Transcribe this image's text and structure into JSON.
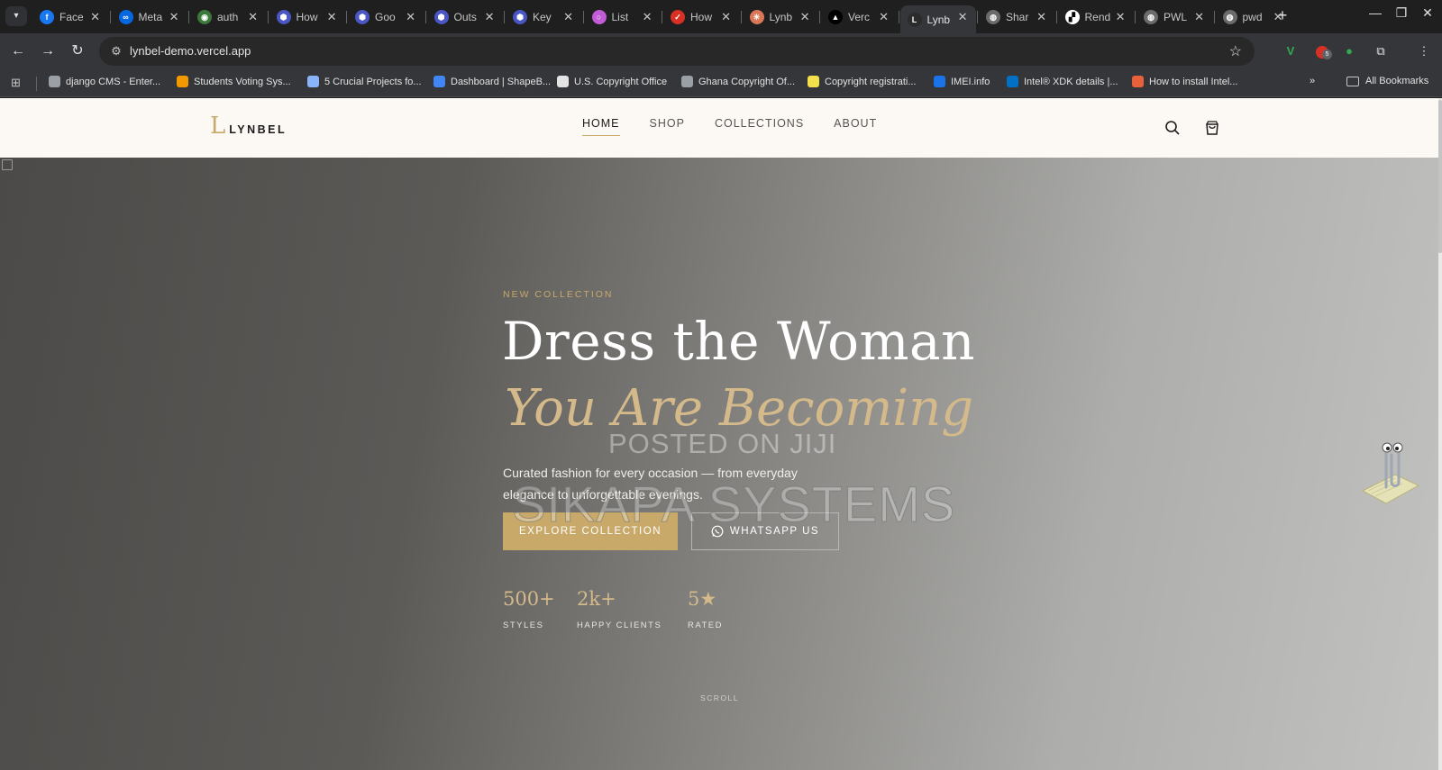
{
  "browser": {
    "tabs": [
      {
        "title": "Face",
        "favicon": "facebook-icon",
        "color": "#1877f2",
        "glyph": "f"
      },
      {
        "title": "Meta",
        "favicon": "meta-icon",
        "color": "#0668e1",
        "glyph": "∞"
      },
      {
        "title": "auth",
        "favicon": "eye-icon",
        "color": "#3c7a3c",
        "glyph": "◉"
      },
      {
        "title": "How",
        "favicon": "shield-icon",
        "color": "#4a56c4",
        "glyph": "⬢"
      },
      {
        "title": "Goo",
        "favicon": "shield-icon",
        "color": "#4a56c4",
        "glyph": "⬢"
      },
      {
        "title": "Outs",
        "favicon": "shield-icon",
        "color": "#4a56c4",
        "glyph": "⬢"
      },
      {
        "title": "Key",
        "favicon": "shield-icon",
        "color": "#4a56c4",
        "glyph": "⬢"
      },
      {
        "title": "List",
        "favicon": "ring-icon",
        "color": "#c25bd6",
        "glyph": "○"
      },
      {
        "title": "How",
        "favicon": "check-icon",
        "color": "#d93025",
        "glyph": "✓"
      },
      {
        "title": "Lynb",
        "favicon": "asterisk-icon",
        "color": "#d97757",
        "glyph": "✳"
      },
      {
        "title": "Verc",
        "favicon": "vercel-icon",
        "color": "#000000",
        "glyph": "▲"
      },
      {
        "title": "Lynb",
        "favicon": "lynbel-icon",
        "color": "#2b2b2b",
        "glyph": "L"
      },
      {
        "title": "Shar",
        "favicon": "globe-icon",
        "color": "#6b6b6b",
        "glyph": "◍"
      },
      {
        "title": "Rend",
        "favicon": "render-icon",
        "color": "#ffffff",
        "glyph": "▞"
      },
      {
        "title": "PWL",
        "favicon": "globe-icon",
        "color": "#6b6b6b",
        "glyph": "◍"
      },
      {
        "title": "pwd",
        "favicon": "globe-icon",
        "color": "#6b6b6b",
        "glyph": "◍"
      }
    ],
    "active_tab_index": 11,
    "url": "lynbel-demo.vercel.app",
    "extension_badge": "5",
    "bookmarks": [
      {
        "label": "django CMS - Enter...",
        "color": "#9aa0a6"
      },
      {
        "label": "Students Voting Sys...",
        "color": "#f29900"
      },
      {
        "label": "5 Crucial Projects fo...",
        "color": "#8ab4f8"
      },
      {
        "label": "Dashboard | ShapeB...",
        "color": "#4285f4"
      },
      {
        "label": "U.S. Copyright Office",
        "color": "#e3e3e3"
      },
      {
        "label": "Ghana Copyright Of...",
        "color": "#9aa0a6"
      },
      {
        "label": "Copyright registrati...",
        "color": "#f4e04d"
      },
      {
        "label": "IMEI.info",
        "color": "#1a73e8"
      },
      {
        "label": "Intel® XDK details |...",
        "color": "#0071c5"
      },
      {
        "label": "How to install Intel...",
        "color": "#e8613a"
      }
    ],
    "all_bookmarks_label": "All Bookmarks"
  },
  "site": {
    "logo_mark": "L",
    "logo_text": "LYNBEL",
    "nav": [
      {
        "label": "HOME",
        "active": true
      },
      {
        "label": "SHOP",
        "active": false
      },
      {
        "label": "COLLECTIONS",
        "active": false
      },
      {
        "label": "ABOUT",
        "active": false
      }
    ],
    "accent_color": "#c8a96a"
  },
  "hero": {
    "eyebrow": "NEW COLLECTION",
    "title_line1": "Dress the Woman",
    "title_line2": "You Are Becoming",
    "lede": "Curated fashion for every occasion — from everyday elegance to unforgettable evenings.",
    "cta_primary": "EXPLORE COLLECTION",
    "cta_secondary": "WHATSAPP US",
    "stats": [
      {
        "value": "500+",
        "label": "STYLES"
      },
      {
        "value": "2k+",
        "label": "HAPPY CLIENTS"
      },
      {
        "value": "5★",
        "label": "RATED"
      }
    ],
    "scroll_label": "SCROLL"
  },
  "watermarks": {
    "line1": "POSTED ON JIJI",
    "line2": "SIKAPA SYSTEMS"
  }
}
